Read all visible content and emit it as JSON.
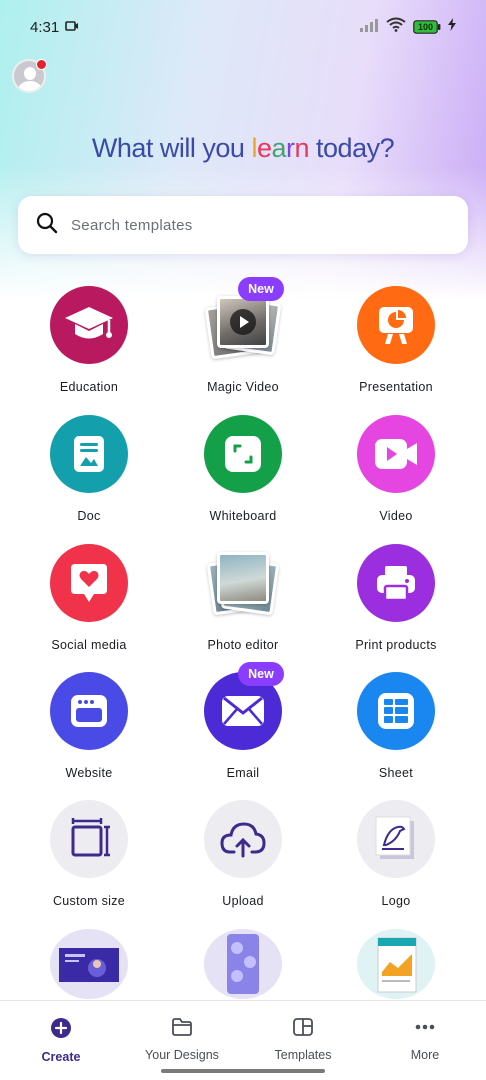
{
  "status": {
    "time": "4:31",
    "battery": "100"
  },
  "headline": {
    "before": "What will you ",
    "accent_letters": [
      "l",
      "e",
      "a",
      "r",
      "n"
    ],
    "after": " today?"
  },
  "search": {
    "placeholder": "Search templates"
  },
  "badge_new": "New",
  "tiles": [
    {
      "label": "Education",
      "icon": "graduation-cap-icon",
      "color": "#b8195f"
    },
    {
      "label": "Magic Video",
      "icon": "magic-video-icon",
      "color": "#ffffff"
    },
    {
      "label": "Presentation",
      "icon": "presentation-icon",
      "color": "#ff6a13"
    },
    {
      "label": "Doc",
      "icon": "doc-icon",
      "color": "#149fad"
    },
    {
      "label": "Whiteboard",
      "icon": "whiteboard-icon",
      "color": "#13a048"
    },
    {
      "label": "Video",
      "icon": "video-icon",
      "color": "#e545e0"
    },
    {
      "label": "Social media",
      "icon": "social-heart-icon",
      "color": "#f0324a"
    },
    {
      "label": "Photo editor",
      "icon": "photo-editor-icon",
      "color": "#ffffff"
    },
    {
      "label": "Print products",
      "icon": "printer-icon",
      "color": "#9b2fe0"
    },
    {
      "label": "Website",
      "icon": "website-icon",
      "color": "#4a4be6"
    },
    {
      "label": "Email",
      "icon": "email-icon",
      "color": "#4c2ad6"
    },
    {
      "label": "Sheet",
      "icon": "sheet-icon",
      "color": "#1a87f0"
    },
    {
      "label": "Custom size",
      "icon": "custom-size-icon",
      "color": "#ececf1"
    },
    {
      "label": "Upload",
      "icon": "upload-cloud-icon",
      "color": "#ececf1"
    },
    {
      "label": "Logo",
      "icon": "logo-icon",
      "color": "#ececf1"
    }
  ],
  "nav": {
    "create": "Create",
    "designs": "Your Designs",
    "templates": "Templates",
    "more": "More"
  },
  "colors": {
    "brand_purple": "#8b3dff",
    "nav_active": "#3d2a8a"
  }
}
